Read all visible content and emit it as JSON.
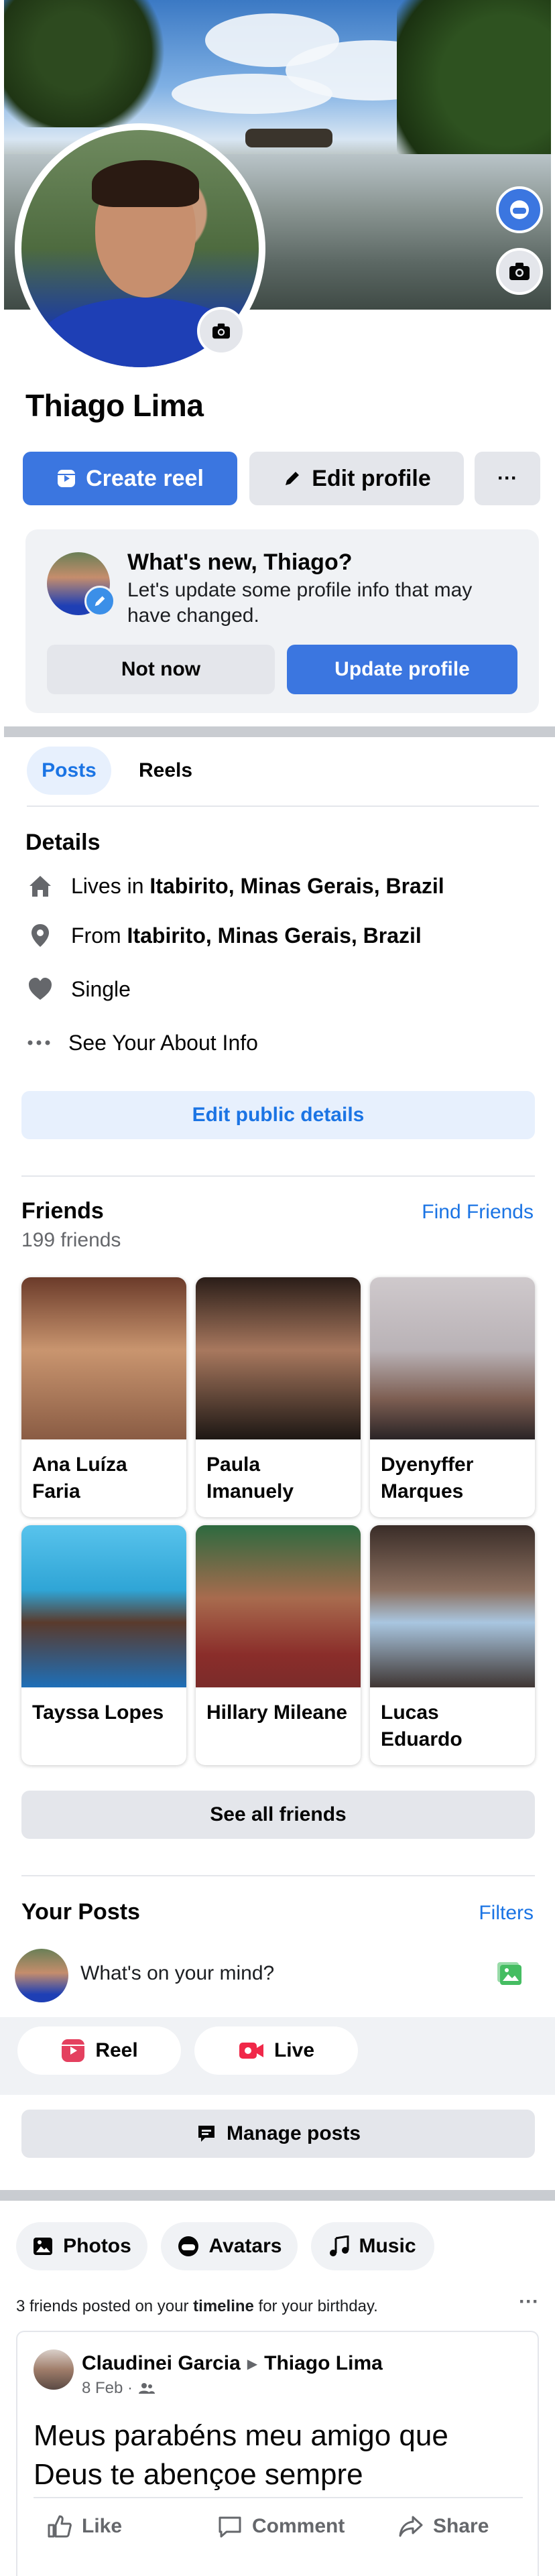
{
  "profile": {
    "name": "Thiago Lima",
    "create_reel": "Create reel",
    "edit_profile": "Edit profile",
    "more": "···"
  },
  "prompt_card": {
    "title": "What's new, Thiago?",
    "text": "Let's update some profile info that may have changed.",
    "not_now": "Not now",
    "update": "Update profile"
  },
  "tabs": [
    "Posts",
    "Reels"
  ],
  "details": {
    "title": "Details",
    "lives_prefix": "Lives in ",
    "lives_place": "Itabirito, Minas Gerais, Brazil",
    "from_prefix": "From ",
    "from_place": "Itabirito, Minas Gerais, Brazil",
    "relationship": "Single",
    "about": "See Your About Info",
    "edit": "Edit public details"
  },
  "friends": {
    "title": "Friends",
    "count": "199 friends",
    "find": "Find Friends",
    "see_all": "See all friends",
    "items": [
      {
        "name": "Ana Luíza Faria",
        "color": "#7a4a3a"
      },
      {
        "name": "Paula Imanuely",
        "color": "#3c2a22"
      },
      {
        "name": "Dyenyffer Marques",
        "color": "#c9c4c6"
      },
      {
        "name": "Tayssa Lopes",
        "color": "#2fa5d6"
      },
      {
        "name": "Hillary Mileane",
        "color": "#7b2c2a"
      },
      {
        "name": "Lucas Eduardo",
        "color": "#5a4a44"
      }
    ]
  },
  "your_posts": {
    "title": "Your Posts",
    "filters": "Filters",
    "composer": "What's on your mind?",
    "reel": "Reel",
    "live": "Live",
    "manage": "Manage posts"
  },
  "media_tabs": [
    "Photos",
    "Avatars",
    "Music"
  ],
  "timeline_note": {
    "prefix": "3 friends posted on your ",
    "bold": "timeline",
    "suffix": " for your birthday.",
    "more": "···"
  },
  "post": {
    "author": "Claudinei Garcia",
    "arrow": "▶",
    "target": "Thiago Lima",
    "date": "8 Feb ·",
    "text": "Meus parabéns meu amigo que Deus te abençoe sempre",
    "like": "Like",
    "comment": "Comment",
    "share": "Share"
  },
  "colors": {
    "accent": "#3b76e0",
    "link": "#1b74e4",
    "grey_button": "#e4e6eb",
    "card_bg": "#f0f2f5"
  }
}
